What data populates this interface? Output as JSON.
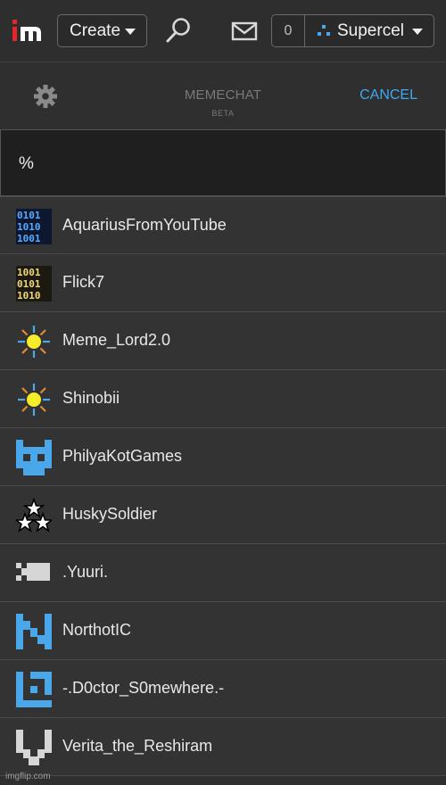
{
  "topbar": {
    "logo_text": "im",
    "create_label": "Create",
    "points": "0",
    "username": "Supercel"
  },
  "chat": {
    "title": "MEMECHAT",
    "subtitle": "BETA",
    "cancel_label": "CANCEL"
  },
  "search": {
    "value": "%"
  },
  "users": [
    {
      "name": "AquariusFromYouTube",
      "avatar": "binary-blue-icon"
    },
    {
      "name": "Flick7",
      "avatar": "binary-yellow-icon"
    },
    {
      "name": "Meme_Lord2.0",
      "avatar": "sun-icon"
    },
    {
      "name": "Shinobii",
      "avatar": "sun-icon"
    },
    {
      "name": "PhilyaKotGames",
      "avatar": "pixel-cat-icon"
    },
    {
      "name": "HuskySoldier",
      "avatar": "three-stars-icon"
    },
    {
      "name": ".Yuuri.",
      "avatar": "pixel-block-icon"
    },
    {
      "name": "NorthotIC",
      "avatar": "pixel-n-icon"
    },
    {
      "name": "-.D0ctor_S0mewhere.-",
      "avatar": "pixel-square-icon"
    },
    {
      "name": "Verita_the_Reshiram",
      "avatar": "pixel-v-icon"
    }
  ],
  "colors": {
    "accent": "#3fa9f0",
    "logo_red": "#e4262a",
    "avatar_blue": "#4aa7ea"
  },
  "watermark": "imgflip.com"
}
